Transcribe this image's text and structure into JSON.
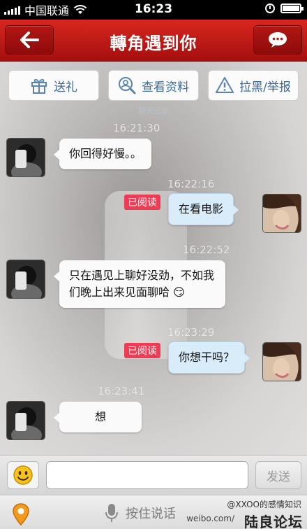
{
  "status_bar": {
    "carrier": "中国联通",
    "time": "16:23"
  },
  "nav": {
    "title": "轉角遇到你"
  },
  "actions": {
    "gift": "送礼",
    "profile": "查看资料",
    "block": "拉黑/举报"
  },
  "history_label": "聊天记录",
  "messages": [
    {
      "time": "16:21:30",
      "side": "in",
      "text": "你回得好慢。。"
    },
    {
      "time": "16:22:16",
      "side": "out",
      "read": "已阅读",
      "text": "在看电影"
    },
    {
      "time": "16:22:52",
      "side": "in",
      "line1": "只在遇见上聊好没劲，不如我",
      "line2": "们晚上出来见面聊哈",
      "emoji": "😏"
    },
    {
      "time": "16:23:29",
      "side": "out",
      "read": "已阅读",
      "text": "你想干吗？"
    },
    {
      "time": "16:23:41",
      "side": "in",
      "text": "想"
    }
  ],
  "input": {
    "placeholder": "",
    "send": "发送"
  },
  "bottom": {
    "push_to_talk": "按住说话"
  },
  "watermark": {
    "line1": "@XXOO的感情知识",
    "url": "weibo.com/",
    "brand": "陆良论坛"
  },
  "colors": {
    "nav_red": "#c01a17",
    "link_blue": "#3d6a9a",
    "read_badge": "#ef3c55",
    "out_bubble": "#d9ecf9"
  }
}
